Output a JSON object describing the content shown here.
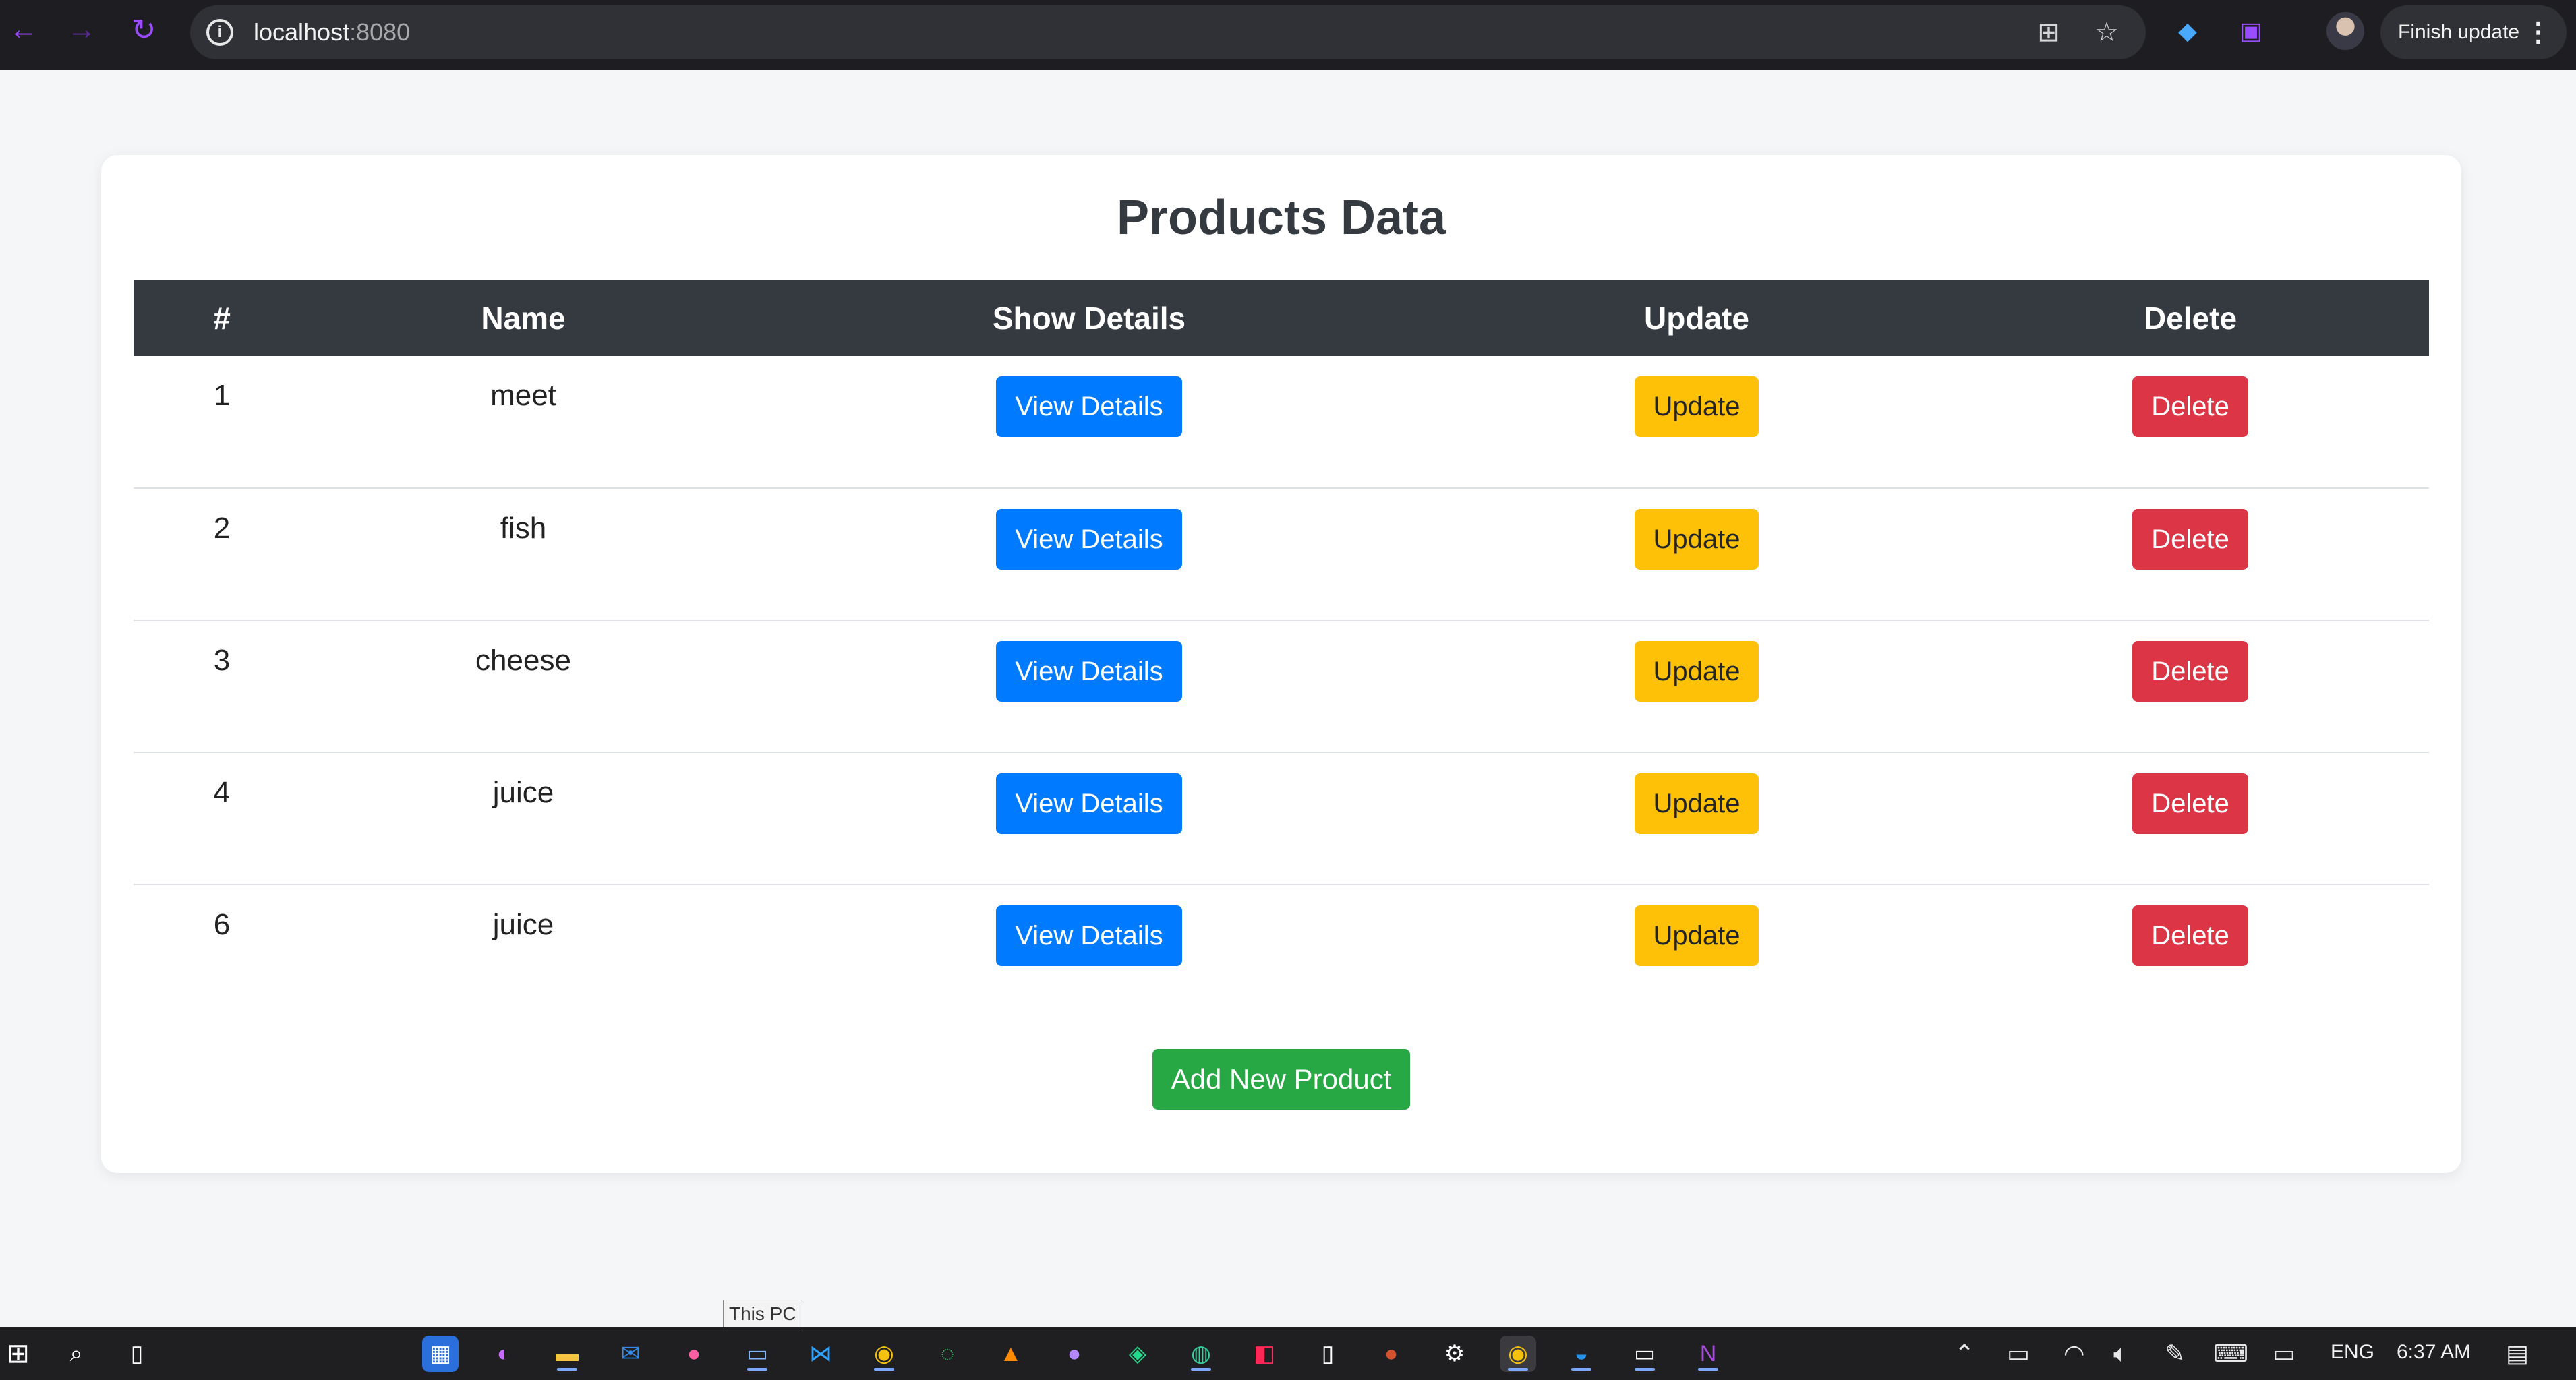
{
  "browser": {
    "url_host": "localhost",
    "url_port": ":8080",
    "finish_update_label": "Finish update",
    "icons": [
      "back-arrow-icon",
      "forward-arrow-icon",
      "reload-icon",
      "site-info-icon",
      "translate-icon",
      "star-icon",
      "gem-extension-icon",
      "puzzle-extension-icon",
      "profile-avatar",
      "kebab-menu-icon"
    ]
  },
  "page": {
    "title": "Products Data",
    "table": {
      "headers": [
        "#",
        "Name",
        "Show Details",
        "Update",
        "Delete"
      ],
      "rows": [
        {
          "id": "1",
          "name": "meet"
        },
        {
          "id": "2",
          "name": "fish"
        },
        {
          "id": "3",
          "name": "cheese"
        },
        {
          "id": "4",
          "name": "juice"
        },
        {
          "id": "6",
          "name": "juice"
        }
      ],
      "view_label": "View Details",
      "update_label": "Update",
      "delete_label": "Delete"
    },
    "add_label": "Add New Product"
  },
  "taskbar": {
    "tooltip": "This PC",
    "language": "ENG",
    "time": "6:37 AM"
  },
  "colors": {
    "primary": "#007bff",
    "warning": "#ffc107",
    "danger": "#dc3545",
    "success": "#28a745",
    "table_header": "#343a40"
  }
}
